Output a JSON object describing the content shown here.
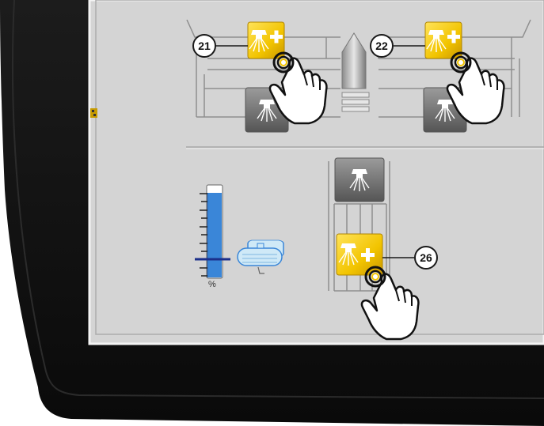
{
  "screen": {
    "callouts": {
      "c21": "21",
      "c22": "22",
      "c26": "26"
    },
    "tank_gauge": {
      "unit_label": "%",
      "level_fraction": 0.4
    },
    "buttons": [
      {
        "name": "left-boom-nozzle-add",
        "icon": "spray-nozzle-plus-icon",
        "state": "active"
      },
      {
        "name": "right-boom-nozzle-add",
        "icon": "spray-nozzle-plus-icon",
        "state": "active"
      },
      {
        "name": "rear-nozzle-add",
        "icon": "spray-nozzle-plus-icon",
        "state": "active"
      }
    ],
    "colors": {
      "screen_bg": "#d4d4d4",
      "bezel": "#141414",
      "button_active": "#f2c400",
      "button_inactive": "#7a7a7a",
      "gauge_fill": "#3a86d8",
      "tank_fill": "#bfe3f5"
    }
  }
}
